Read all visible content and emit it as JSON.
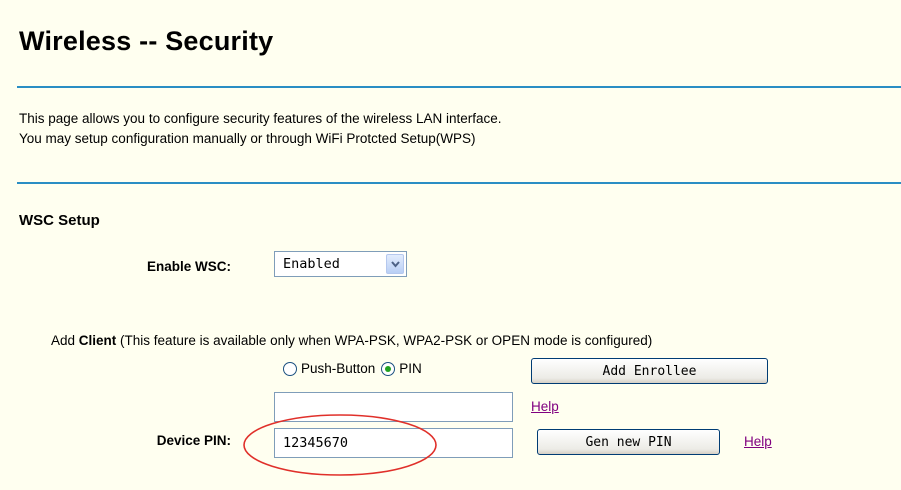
{
  "page": {
    "title": "Wireless -- Security",
    "description_line1": "This page allows you to configure security features of the wireless LAN interface.",
    "description_line2": "You may setup configuration manually or through WiFi Protcted Setup(WPS)"
  },
  "wsc": {
    "section_title": "WSC Setup",
    "enable_label": "Enable WSC:",
    "enable_value": "Enabled",
    "add_client_bold": "Client",
    "add_client_prefix": "Add ",
    "add_client_suffix": " (This feature is available only when WPA-PSK, WPA2-PSK or OPEN mode is configured)",
    "radio_push_button": "Push-Button",
    "radio_pin": "PIN",
    "selected_mode": "PIN",
    "add_enrollee_label": "Add Enrollee",
    "enrollee_pin_value": "",
    "help_label": "Help",
    "device_pin_label": "Device PIN:",
    "device_pin_value": "12345670",
    "gen_pin_label": "Gen new PIN",
    "help_label_2": "Help"
  },
  "colors": {
    "background": "#fffff0",
    "divider": "#2a8ec4",
    "link_visited": "#800080",
    "annotation": "#e0302a"
  }
}
